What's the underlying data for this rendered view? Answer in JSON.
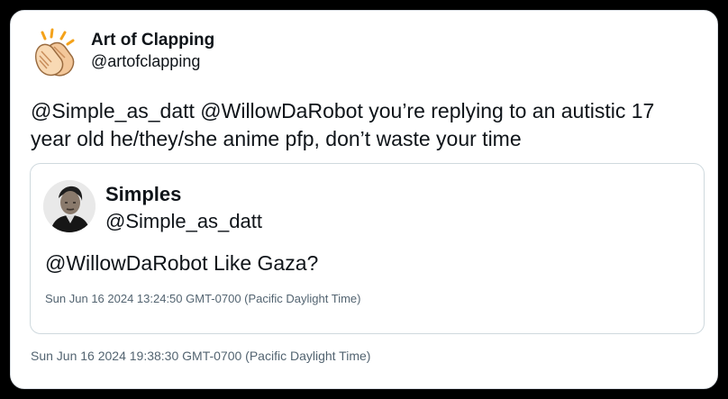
{
  "tweet": {
    "author": {
      "name": "Art of Clapping",
      "handle": "@artofclapping",
      "avatar_icon": "clapping-hands-icon"
    },
    "text": "@Simple_as_datt @WillowDaRobot you’re replying to an autistic 17 year old he/they/she anime pfp, don’t waste your time",
    "timestamp": "Sun Jun 16 2024 19:38:30 GMT-0700 (Pacific Daylight Time)"
  },
  "quoted_tweet": {
    "author": {
      "name": "Simples",
      "handle": "@Simple_as_datt",
      "avatar_icon": "portrait-avatar-icon"
    },
    "text": "@WillowDaRobot Like Gaza?",
    "timestamp": "Sun Jun 16 2024 13:24:50 GMT-0700 (Pacific Daylight Time)"
  },
  "colors": {
    "background": "#000000",
    "card": "#ffffff",
    "text": "#0f1419",
    "muted": "#536471",
    "border": "#cfd9de"
  }
}
